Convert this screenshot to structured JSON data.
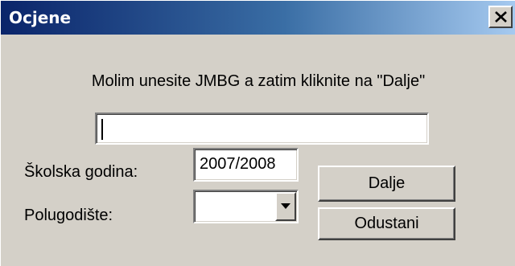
{
  "window": {
    "title": "Ocjene",
    "close_label": "X"
  },
  "form": {
    "prompt": "Molim unesite JMBG a zatim kliknite na \"Dalje\"",
    "jmbg_value": "",
    "school_year_label": "Školska godina:",
    "school_year_value": "2007/2008",
    "semester_label": "Polugodište:",
    "semester_value": ""
  },
  "buttons": {
    "next_label": "Dalje",
    "cancel_label": "Odustani"
  },
  "icons": {
    "close": "close-icon",
    "dropdown": "chevron-down-icon"
  },
  "colors": {
    "titlebar_start": "#0a246a",
    "titlebar_end": "#a6caf0",
    "face": "#d4d0c8"
  }
}
